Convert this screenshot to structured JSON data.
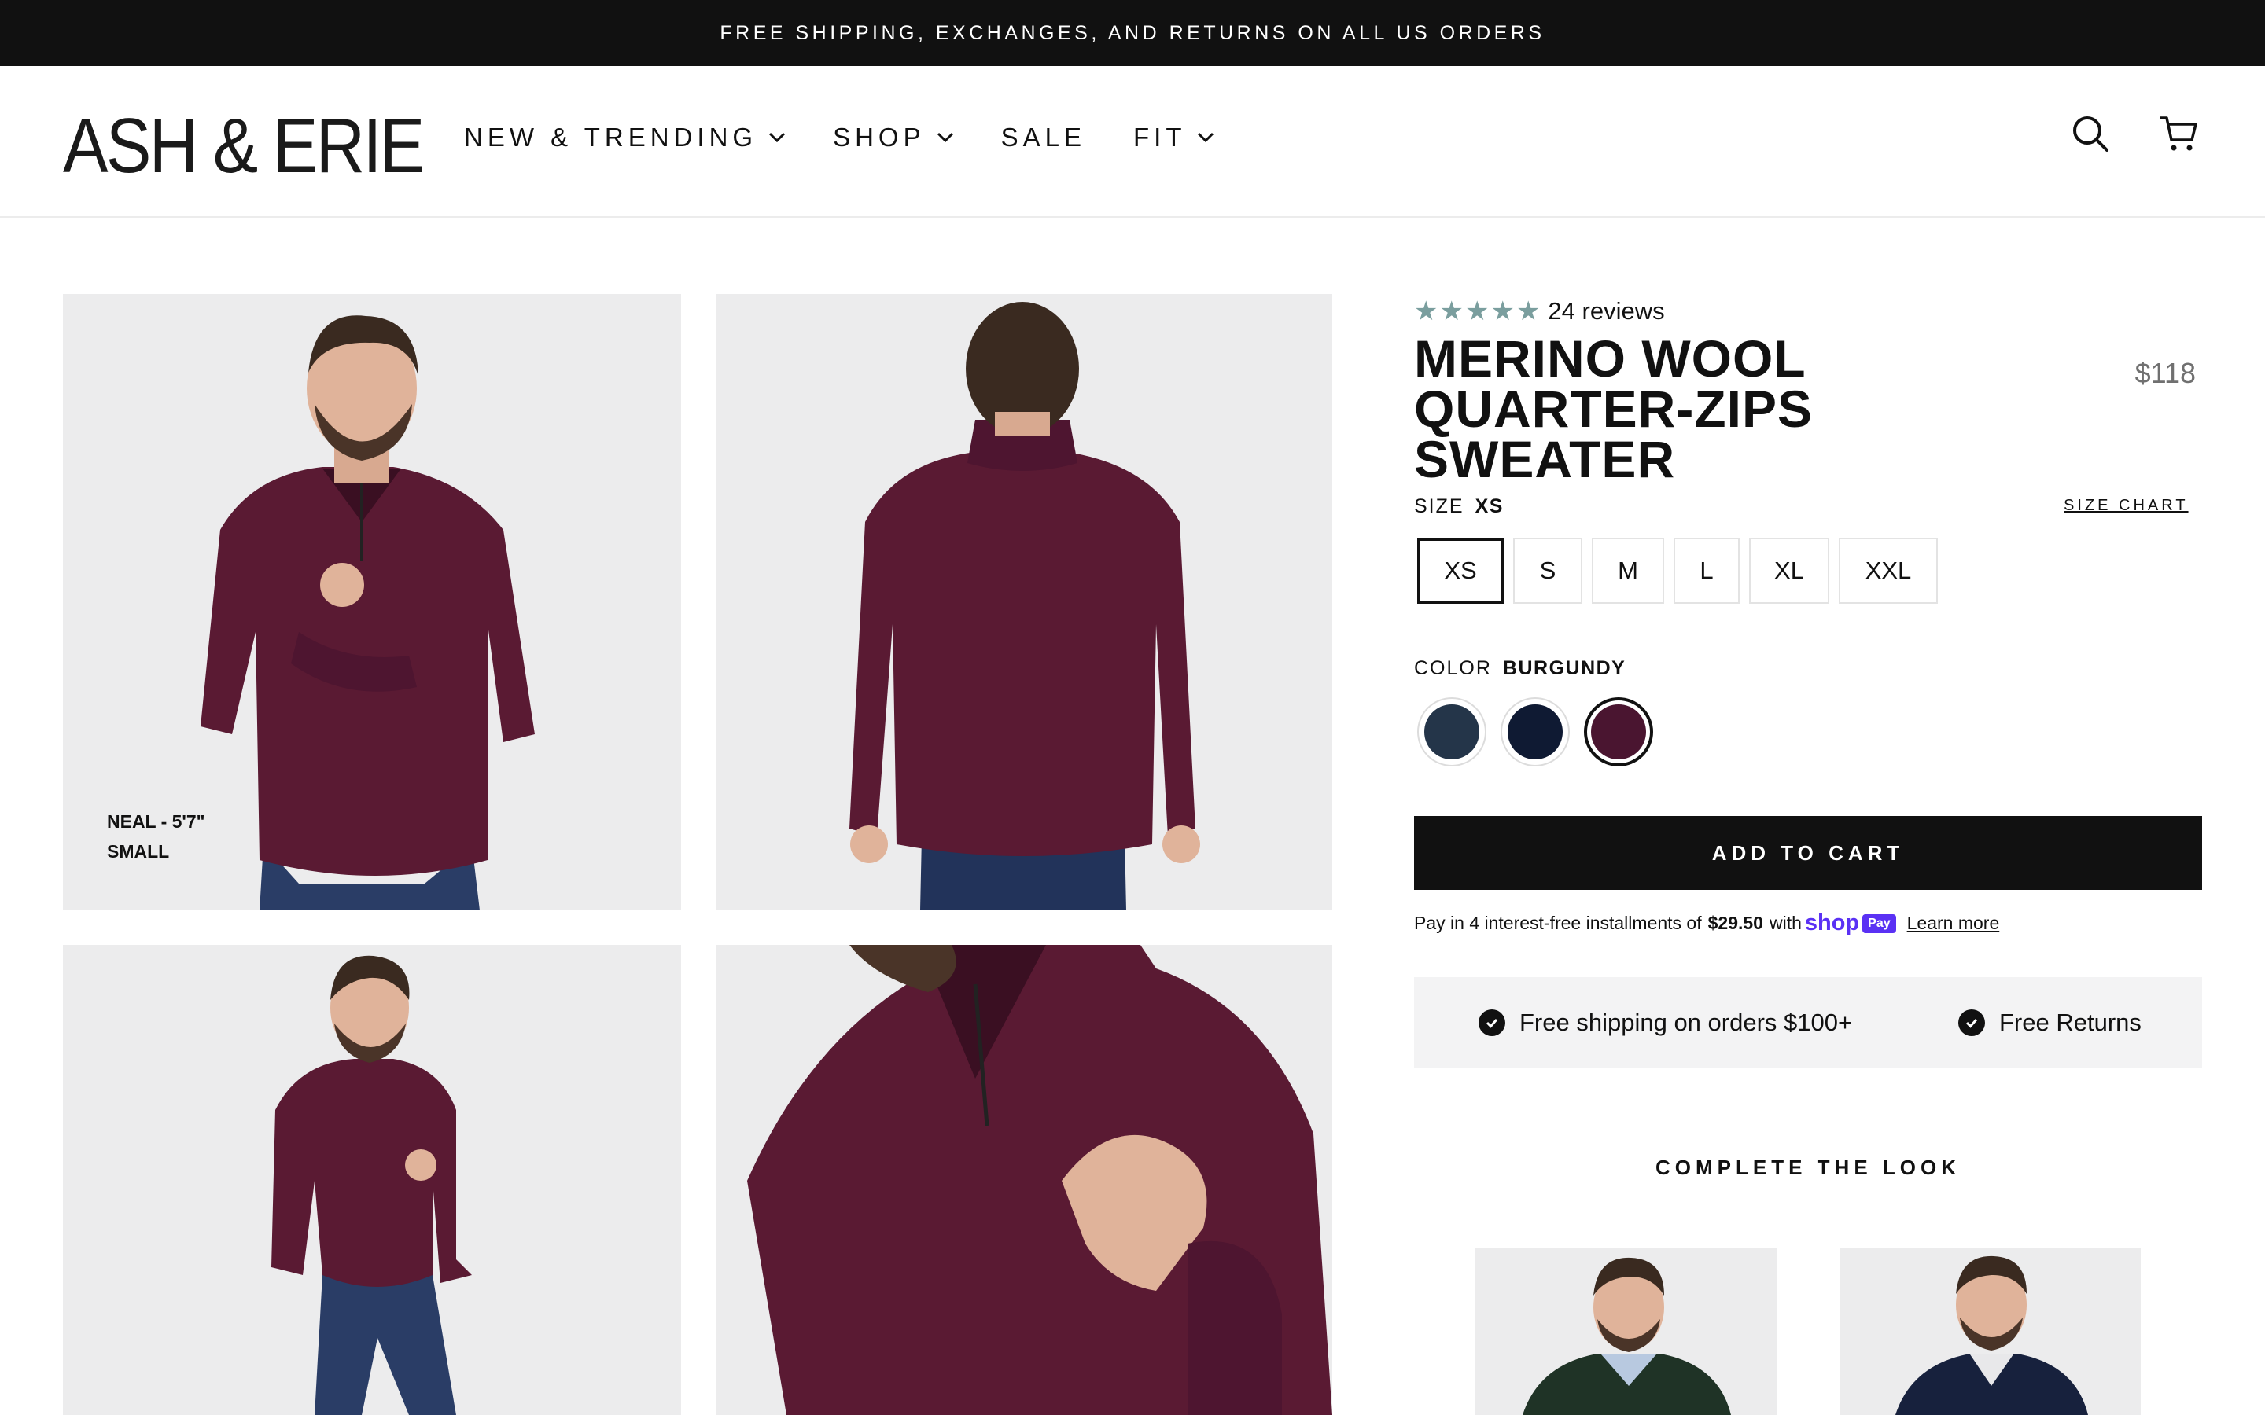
{
  "announcement": "FREE SHIPPING, EXCHANGES, AND RETURNS ON ALL US ORDERS",
  "header": {
    "logo": "ASH & ERIE",
    "nav": [
      {
        "label": "NEW & TRENDING",
        "has_dropdown": true
      },
      {
        "label": "SHOP",
        "has_dropdown": true
      },
      {
        "label": "SALE",
        "has_dropdown": false
      },
      {
        "label": "FIT",
        "has_dropdown": true
      }
    ],
    "icons": [
      "search-icon",
      "cart-icon"
    ]
  },
  "gallery": {
    "model_caption_line1": "NEAL - 5'7\"",
    "model_caption_line2": "SMALL"
  },
  "product": {
    "rating_stars": 5,
    "reviews": "24 reviews",
    "title": "MERINO WOOL QUARTER-ZIPS SWEATER",
    "price": "$118",
    "size_label": "SIZE",
    "selected_size": "XS",
    "size_chart": "SIZE CHART",
    "sizes": [
      "XS",
      "S",
      "M",
      "L",
      "XL",
      "XXL"
    ],
    "color_label": "COLOR",
    "selected_color": "BURGUNDY",
    "colors": [
      {
        "name": "slate-navy",
        "hex": "#243549"
      },
      {
        "name": "navy",
        "hex": "#0f1a33"
      },
      {
        "name": "burgundy",
        "hex": "#4a1530"
      }
    ],
    "add_to_cart": "ADD TO CART",
    "shoppay": {
      "prefix": "Pay in 4 interest-free installments of",
      "amount": "$29.50",
      "with": "with",
      "brand": "shop",
      "badge": "Pay",
      "learn_more": "Learn more"
    },
    "benefits": [
      "Free shipping on orders $100+",
      "Free Returns"
    ],
    "complete_the_look": "COMPLETE THE LOOK"
  },
  "colors": {
    "burgundy_sweater": "#5a1a33",
    "jeans": "#2a3d66",
    "photo_bg": "#ececed",
    "star": "#7a9e9e",
    "shop_purple": "#5a31f4"
  }
}
